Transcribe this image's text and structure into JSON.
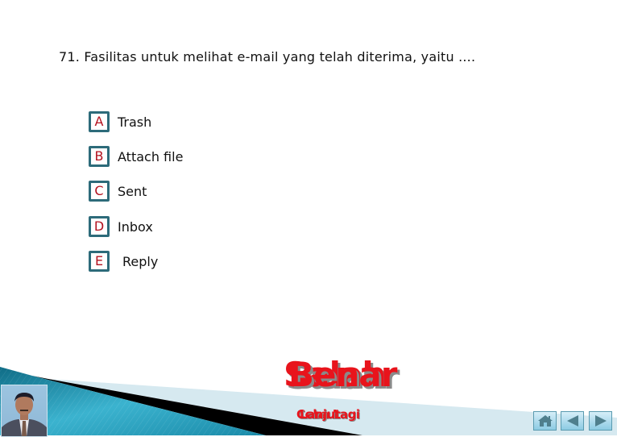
{
  "question": {
    "number": "71.",
    "text": "Fasilitas untuk melihat e-mail yang telah diterima, yaitu ...."
  },
  "options": [
    {
      "letter": "A",
      "label": "Trash"
    },
    {
      "letter": "B",
      "label": "Attach file"
    },
    {
      "letter": "C",
      "label": "Sent"
    },
    {
      "letter": "D",
      "label": "Inbox"
    },
    {
      "letter": "E",
      "label": "Reply"
    }
  ],
  "feedback": {
    "wrong_label": "Salah",
    "right_label": "Benar",
    "retry_label": "Coba Lagi",
    "next_label": "Lanjut"
  },
  "navigation": {
    "home_icon": "home-icon",
    "prev_icon": "triangle-left-icon",
    "next_icon": "triangle-right-icon"
  },
  "colors": {
    "option_border": "#2d6b7a",
    "option_letter": "#b3121f",
    "feedback_red": "#e8141c",
    "band_teal": "#1f8aa6",
    "band_light": "#d6e9f0"
  }
}
